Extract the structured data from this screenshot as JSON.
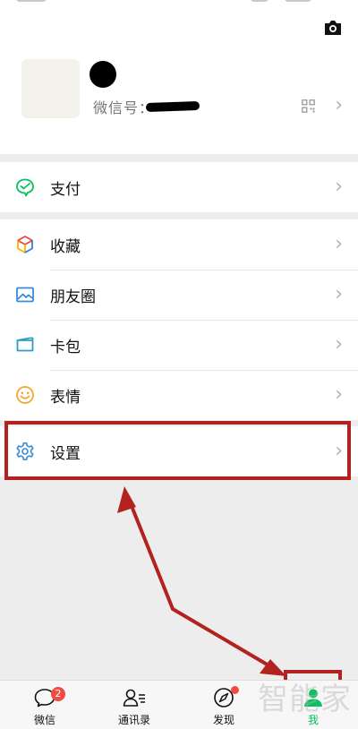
{
  "profile": {
    "wechat_id_label": "微信号："
  },
  "menu": {
    "pay": "支付",
    "favorites": "收藏",
    "moments": "朋友圈",
    "cards": "卡包",
    "stickers": "表情",
    "settings": "设置"
  },
  "tabbar": {
    "chats": "微信",
    "chats_badge": "2",
    "contacts": "通讯录",
    "discover": "发现",
    "me": "我"
  },
  "colors": {
    "accent": "#07c160",
    "highlight": "#b2221e",
    "badge": "#f04c44"
  },
  "watermark": "智能家"
}
